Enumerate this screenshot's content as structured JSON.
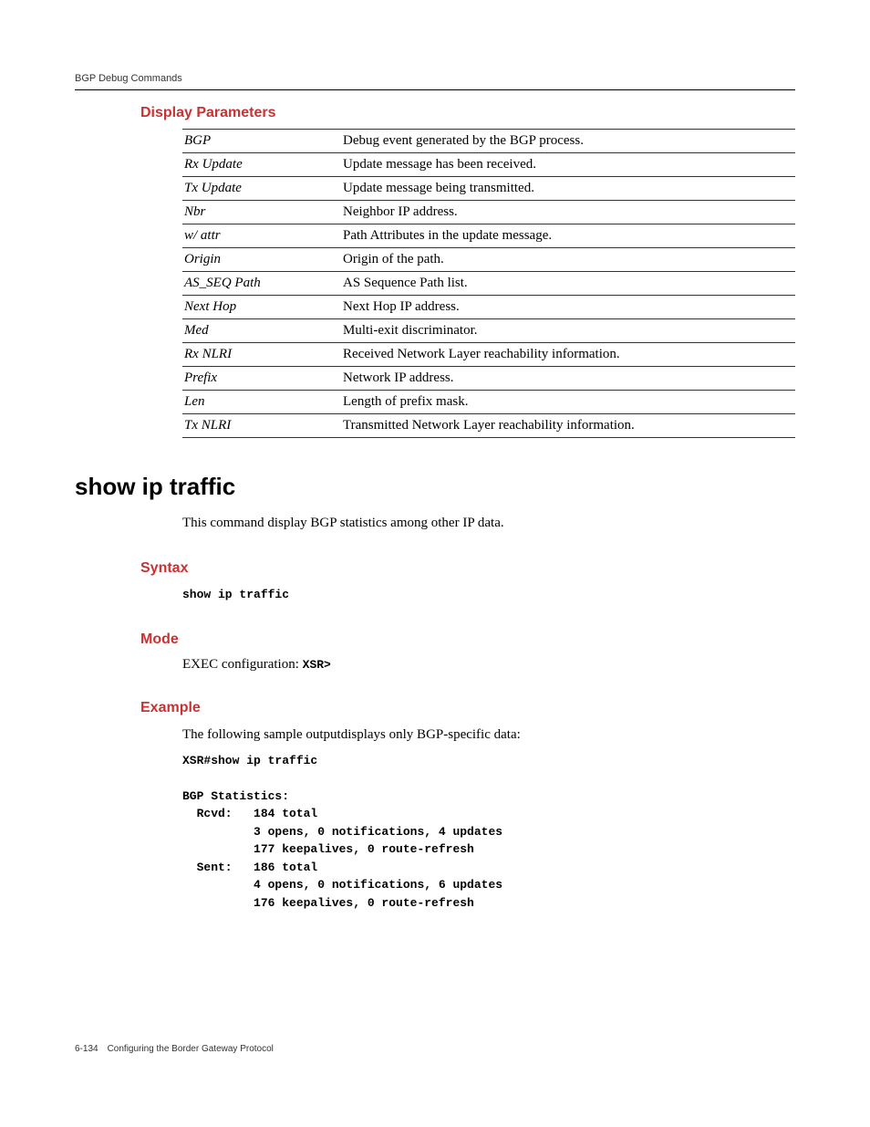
{
  "header": {
    "title": "BGP Debug Commands"
  },
  "display_parameters": {
    "heading": "Display Parameters",
    "rows": [
      {
        "term": "BGP",
        "desc": "Debug event generated by the BGP process."
      },
      {
        "term": "Rx Update",
        "desc": "Update message has been received."
      },
      {
        "term": "Tx Update",
        "desc": "Update message being transmitted."
      },
      {
        "term": "Nbr",
        "desc": "Neighbor IP address."
      },
      {
        "term": "w/ attr",
        "desc": "Path Attributes in the update message."
      },
      {
        "term": "Origin",
        "desc": "Origin of the path."
      },
      {
        "term": "AS_SEQ Path",
        "desc": "AS Sequence Path list."
      },
      {
        "term": "Next Hop",
        "desc": "Next Hop IP address."
      },
      {
        "term": "Med",
        "desc": "Multi-exit discriminator."
      },
      {
        "term": "Rx NLRI",
        "desc": "Received Network Layer reachability information."
      },
      {
        "term": "Prefix",
        "desc": "Network IP address."
      },
      {
        "term": "Len",
        "desc": "Length of prefix mask."
      },
      {
        "term": "Tx NLRI",
        "desc": "Transmitted Network Layer reachability information."
      }
    ]
  },
  "command": {
    "heading": "show ip traffic",
    "intro": "This command display BGP statistics among other IP data."
  },
  "syntax": {
    "heading": "Syntax",
    "code": "show ip traffic"
  },
  "mode": {
    "heading": "Mode",
    "label": "EXEC configuration: ",
    "prompt": "XSR>"
  },
  "example": {
    "heading": "Example",
    "intro": "The following sample outputdisplays only BGP-specific data:",
    "code": "XSR#show ip traffic\n\nBGP Statistics:\n  Rcvd:   184 total\n          3 opens, 0 notifications, 4 updates\n          177 keepalives, 0 route-refresh\n  Sent:   186 total\n          4 opens, 0 notifications, 6 updates\n          176 keepalives, 0 route-refresh"
  },
  "footer": {
    "pagenum": "6-134",
    "title": "Configuring the Border Gateway Protocol"
  }
}
